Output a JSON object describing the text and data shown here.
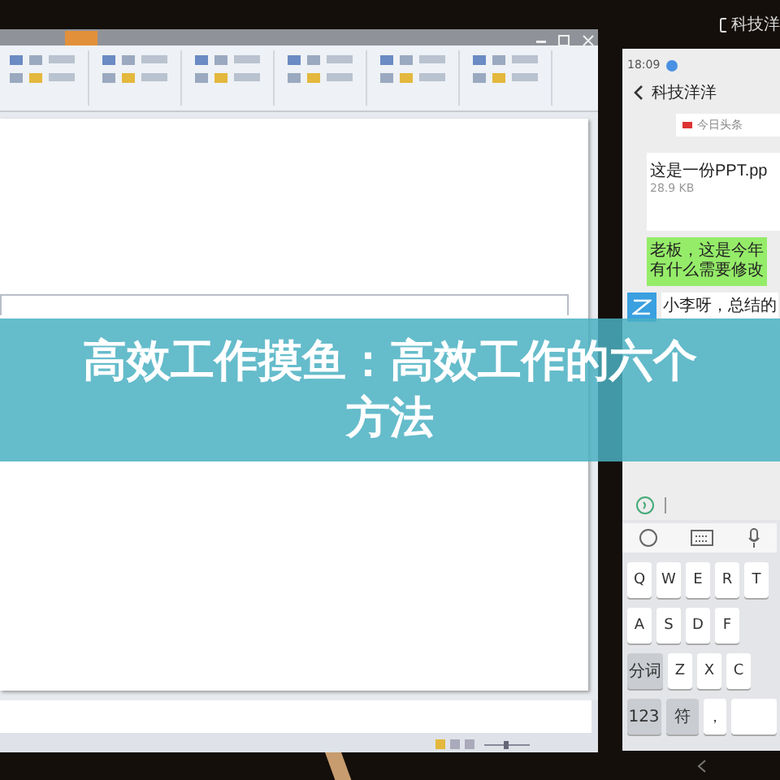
{
  "banner": {
    "title": "高效工作摸鱼：高效工作的六个方法"
  },
  "phone": {
    "device_label": "科技洋",
    "time": "18:09",
    "chat_title": "科技洋洋",
    "source": "今日头条",
    "messages": [
      {
        "kind": "file",
        "text": "这是一份PPT.pp",
        "size": "28.9 KB"
      },
      {
        "kind": "sent",
        "text": "老板，这是今年有什么需要修改"
      },
      {
        "kind": "received",
        "text": "小李呀，总结的"
      }
    ],
    "keyboard": {
      "rows": [
        [
          {
            "label": "Q",
            "kind": "letter"
          },
          {
            "label": "W",
            "kind": "letter"
          },
          {
            "label": "E",
            "kind": "letter"
          },
          {
            "label": "R",
            "kind": "letter"
          },
          {
            "label": "T",
            "kind": "letter"
          }
        ],
        [
          {
            "label": "A",
            "kind": "letter"
          },
          {
            "label": "S",
            "kind": "letter"
          },
          {
            "label": "D",
            "kind": "letter"
          },
          {
            "label": "F",
            "kind": "letter"
          }
        ],
        [
          {
            "label": "分词",
            "kind": "function"
          },
          {
            "label": "Z",
            "kind": "letter"
          },
          {
            "label": "X",
            "kind": "letter"
          },
          {
            "label": "C",
            "kind": "letter"
          }
        ],
        [
          {
            "label": "123",
            "kind": "function"
          },
          {
            "label": "符",
            "kind": "function"
          },
          {
            "label": "，",
            "kind": "letter"
          },
          {
            "kind": "space"
          }
        ]
      ]
    }
  }
}
